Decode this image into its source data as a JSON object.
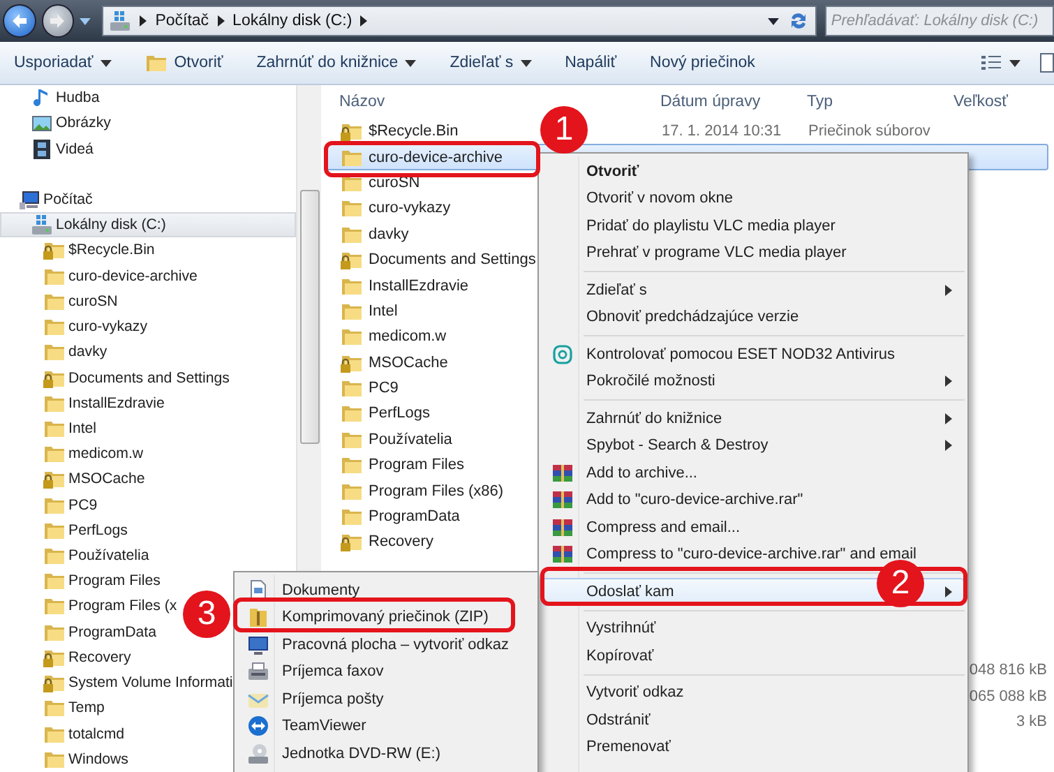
{
  "address": {
    "crumbs": [
      "Počítač",
      "Lokálny disk (C:)"
    ]
  },
  "search": {
    "placeholder": "Prehľadávať: Lokálny disk (C:)"
  },
  "toolbar": [
    {
      "label": "Usporiadať",
      "dropdown": true,
      "kind": "command"
    },
    {
      "label": "Otvoriť",
      "dropdown": false,
      "kind": "open"
    },
    {
      "label": "Zahrnúť do knižnice",
      "dropdown": true,
      "kind": "command"
    },
    {
      "label": "Zdieľať s",
      "dropdown": true,
      "kind": "command"
    },
    {
      "label": "Napáliť",
      "dropdown": false,
      "kind": "command"
    },
    {
      "label": "Nový priečinok",
      "dropdown": false,
      "kind": "command"
    }
  ],
  "nav": {
    "libraries": [
      {
        "label": "Hudba",
        "kind": "music"
      },
      {
        "label": "Obrázky",
        "kind": "pictures"
      },
      {
        "label": "Videá",
        "kind": "videos"
      }
    ],
    "computer": {
      "label": "Počítač",
      "children": [
        {
          "label": "Lokálny disk (C:)",
          "selected": true,
          "children": [
            {
              "label": "$Recycle.Bin",
              "locked": true
            },
            {
              "label": "curo-device-archive",
              "locked": false
            },
            {
              "label": "curoSN",
              "locked": false
            },
            {
              "label": "curo-vykazy",
              "locked": false
            },
            {
              "label": "davky",
              "locked": false
            },
            {
              "label": "Documents and Settings",
              "locked": true
            },
            {
              "label": "InstallEzdravie",
              "locked": false
            },
            {
              "label": "Intel",
              "locked": false
            },
            {
              "label": "medicom.w",
              "locked": false
            },
            {
              "label": "MSOCache",
              "locked": true
            },
            {
              "label": "PC9",
              "locked": false
            },
            {
              "label": "PerfLogs",
              "locked": false
            },
            {
              "label": "Používatelia",
              "locked": false
            },
            {
              "label": "Program Files",
              "locked": false
            },
            {
              "label": "Program Files (x",
              "locked": false
            },
            {
              "label": "ProgramData",
              "locked": false
            },
            {
              "label": "Recovery",
              "locked": true
            },
            {
              "label": "System Volume Informati",
              "locked": true
            },
            {
              "label": "Temp",
              "locked": false
            },
            {
              "label": "totalcmd",
              "locked": false
            },
            {
              "label": "Windows",
              "locked": false
            }
          ]
        }
      ]
    }
  },
  "file_list": {
    "columns": [
      "Názov",
      "Dátum úpravy",
      "Typ",
      "Veľkosť"
    ],
    "rows": [
      {
        "name": "$Recycle.Bin",
        "locked": true,
        "selected": false,
        "date": "17. 1. 2014 10:31",
        "type": "Priečinok súborov"
      },
      {
        "name": "curo-device-archive",
        "locked": false,
        "selected": true
      },
      {
        "name": "curoSN",
        "locked": false,
        "selected": false
      },
      {
        "name": "curo-vykazy",
        "locked": false,
        "selected": false
      },
      {
        "name": "davky",
        "locked": false,
        "selected": false
      },
      {
        "name": "Documents and Settings",
        "locked": true,
        "selected": false
      },
      {
        "name": "InstallEzdravie",
        "locked": false,
        "selected": false
      },
      {
        "name": "Intel",
        "locked": false,
        "selected": false
      },
      {
        "name": "medicom.w",
        "locked": false,
        "selected": false
      },
      {
        "name": "MSOCache",
        "locked": true,
        "selected": false
      },
      {
        "name": "PC9",
        "locked": false,
        "selected": false
      },
      {
        "name": "PerfLogs",
        "locked": false,
        "selected": false
      },
      {
        "name": "Používatelia",
        "locked": false,
        "selected": false
      },
      {
        "name": "Program Files",
        "locked": false,
        "selected": false
      },
      {
        "name": "Program Files (x86)",
        "locked": false,
        "selected": false
      },
      {
        "name": "ProgramData",
        "locked": false,
        "selected": false
      },
      {
        "name": "Recovery",
        "locked": true,
        "selected": false
      },
      {
        "selected": false
      },
      {
        "selected": false
      },
      {
        "selected": false
      },
      {
        "selected": false
      },
      {
        "size": "048 816 kB",
        "selected": false
      },
      {
        "size": "065 088 kB",
        "selected": false
      },
      {
        "size": "3 kB",
        "selected": false
      }
    ]
  },
  "context_menu": [
    {
      "kind": "command",
      "label": "Otvoriť",
      "default": true,
      "submenu": false,
      "selected": false
    },
    {
      "kind": "command",
      "label": "Otvoriť v novom okne",
      "default": false,
      "submenu": false,
      "selected": false
    },
    {
      "kind": "command",
      "label": "Pridať do playlistu VLC media player",
      "default": false,
      "submenu": false,
      "selected": false
    },
    {
      "kind": "command",
      "label": "Prehrať v programe VLC media player",
      "default": false,
      "submenu": false,
      "selected": false
    },
    {
      "kind": "separator"
    },
    {
      "kind": "command",
      "label": "Zdieľať s",
      "default": false,
      "submenu": true,
      "selected": false
    },
    {
      "kind": "command",
      "label": "Obnoviť predchádzajúce verzie",
      "default": false,
      "submenu": false,
      "selected": false
    },
    {
      "kind": "separator"
    },
    {
      "kind": "antivirus",
      "label": "Kontrolovať pomocou ESET NOD32 Antivirus",
      "default": false,
      "submenu": false,
      "selected": false
    },
    {
      "kind": "command",
      "label": "Pokročilé možnosti",
      "default": false,
      "submenu": true,
      "selected": false
    },
    {
      "kind": "separator"
    },
    {
      "kind": "command",
      "label": "Zahrnúť do knižnice",
      "default": false,
      "submenu": true,
      "selected": false
    },
    {
      "kind": "command",
      "label": "Spybot - Search & Destroy",
      "default": false,
      "submenu": true,
      "selected": false
    },
    {
      "kind": "archive",
      "label": "Add to archive...",
      "default": false,
      "submenu": false,
      "selected": false
    },
    {
      "kind": "archive",
      "label": "Add to \"curo-device-archive.rar\"",
      "default": false,
      "submenu": false,
      "selected": false
    },
    {
      "kind": "archive",
      "label": "Compress and email...",
      "default": false,
      "submenu": false,
      "selected": false
    },
    {
      "kind": "archive",
      "label": "Compress to \"curo-device-archive.rar\" and email",
      "default": false,
      "submenu": false,
      "selected": false
    },
    {
      "kind": "separator"
    },
    {
      "kind": "command",
      "label": "Odoslať kam",
      "default": false,
      "submenu": true,
      "selected": true
    },
    {
      "kind": "separator"
    },
    {
      "kind": "command",
      "label": "Vystrihnúť",
      "default": false,
      "submenu": false,
      "selected": false
    },
    {
      "kind": "command",
      "label": "Kopírovať",
      "default": false,
      "submenu": false,
      "selected": false
    },
    {
      "kind": "separator"
    },
    {
      "kind": "command",
      "label": "Vytvoriť odkaz",
      "default": false,
      "submenu": false,
      "selected": false
    },
    {
      "kind": "command",
      "label": "Odstrániť",
      "default": false,
      "submenu": false,
      "selected": false
    },
    {
      "kind": "command",
      "label": "Premenovať",
      "default": false,
      "submenu": false,
      "selected": false
    }
  ],
  "send_to_menu": [
    {
      "label": "Dokumenty",
      "kind": "documents"
    },
    {
      "label": "Komprimovaný priečinok (ZIP)",
      "kind": "zip"
    },
    {
      "label": "Pracovná plocha – vytvoriť odkaz",
      "kind": "desktop"
    },
    {
      "label": "Príjemca faxov",
      "kind": "fax"
    },
    {
      "label": "Príjemca pošty",
      "kind": "mail"
    },
    {
      "label": "TeamViewer",
      "kind": "remote"
    },
    {
      "label": "Jednotka DVD-RW (E:)",
      "kind": "drive"
    }
  ],
  "annotations": [
    {
      "number": "1"
    },
    {
      "number": "2"
    },
    {
      "number": "3"
    }
  ]
}
